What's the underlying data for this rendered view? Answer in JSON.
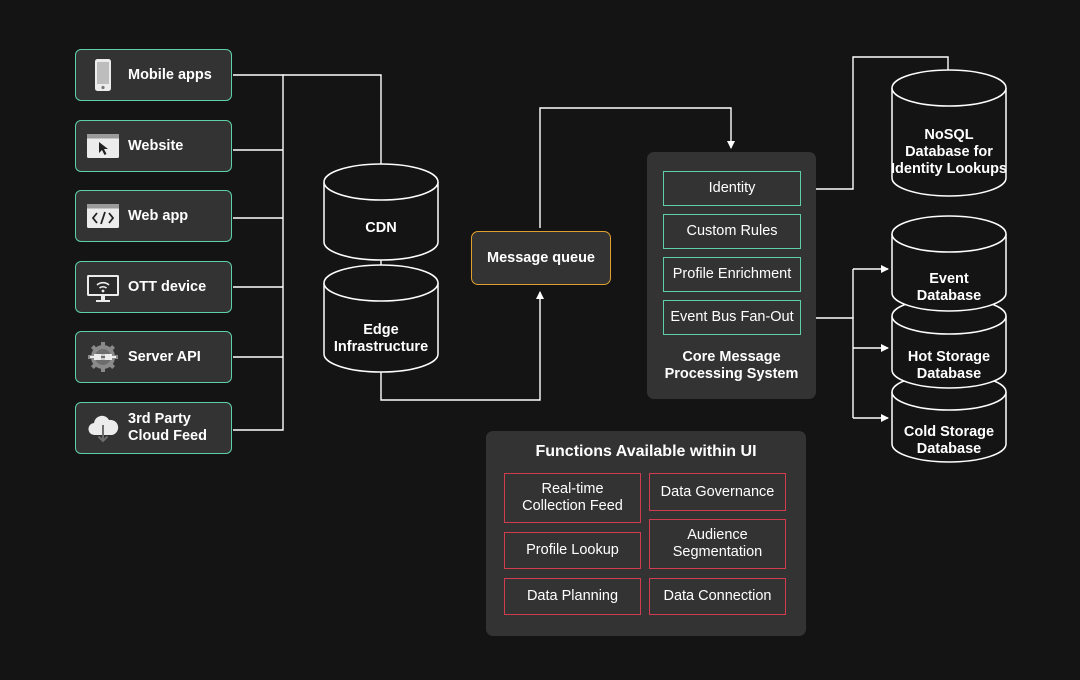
{
  "sources": [
    {
      "label": "Mobile apps",
      "icon": "mobile-phone-icon"
    },
    {
      "label": "Website",
      "icon": "browser-cursor-icon"
    },
    {
      "label": "Web app",
      "icon": "code-window-icon"
    },
    {
      "label": "OTT device",
      "icon": "wifi-tv-icon"
    },
    {
      "label": "Server API",
      "icon": "plug-gear-icon"
    },
    {
      "label": "3rd Party\nCloud Feed",
      "icon": "cloud-download-icon"
    }
  ],
  "cdn": "CDN",
  "edge": "Edge\nInfrastructure",
  "message_queue": "Message queue",
  "core": {
    "title": "Core Message\nProcessing System",
    "items": [
      "Identity",
      "Custom Rules",
      "Profile Enrichment",
      "Event Bus Fan-Out"
    ]
  },
  "databases": {
    "nosql": "NoSQL\nDatabase for\nIdentity Lookups",
    "event": "Event\nDatabase",
    "hot": "Hot Storage\nDatabase",
    "cold": "Cold Storage\nDatabase"
  },
  "functions": {
    "title": "Functions Available within UI",
    "items": [
      "Real-time\nCollection Feed",
      "Data Governance",
      "Profile Lookup",
      "Audience\nSegmentation",
      "Data Planning",
      "Data Connection"
    ]
  },
  "colors": {
    "background": "#141414",
    "panel": "#333333",
    "source_border": "#5fd0a6",
    "queue_border": "#e0a030",
    "function_border": "#d23c4f",
    "line": "#ffffff"
  }
}
